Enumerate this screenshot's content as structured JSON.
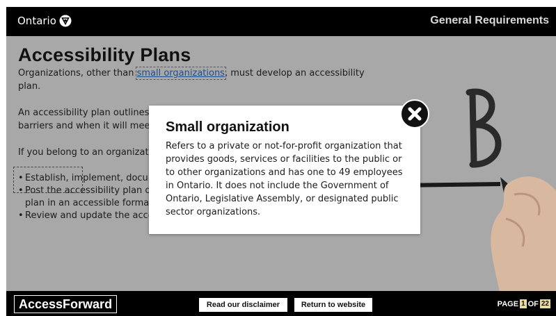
{
  "header": {
    "brand": "Ontario",
    "brand_icon": "ontario-trillium-logo",
    "section_title": "General Requirements"
  },
  "content": {
    "title": "Accessibility Plans",
    "intro_prefix": "Organizations, other than ",
    "intro_link": "small organizations",
    "intro_suffix": ", must develop an accessibility plan.",
    "description": "An accessibility plan outlines how an organization will prevent and remove barriers and when it will meet the requirements of the regulation will be met.",
    "belong": "If you belong to an organization that must develop a plan, you must:",
    "requirements": [
      "Establish, implement, document and maintain a multi-year accessibility plan.",
      "Post the accessibility plan on your website, if you have one, and provide the plan in an accessible format on request.",
      "Review and update the accessibility plan at least once every five years."
    ]
  },
  "modal": {
    "title": "Small organization",
    "body": "Refers to a private or not-for-profit organization that provides goods, services or facilities to the public or to other organizations and has one to 49 employees in Ontario. It does not include the Government of Ontario, Legislative Assembly, or designated public sector organizations.",
    "close_icon": "close-icon"
  },
  "footer": {
    "logo": "AccessForward",
    "disclaimer": "Read our disclaimer",
    "return": "Return to website",
    "page_label": "PAGE",
    "page_current": "1",
    "page_of": "OF",
    "page_total": "22"
  },
  "colors": {
    "header_bg": "#000000",
    "overlay_bg": "#a8a8a8",
    "link": "#1d4f8c",
    "page_highlight": "#e8dca0"
  }
}
